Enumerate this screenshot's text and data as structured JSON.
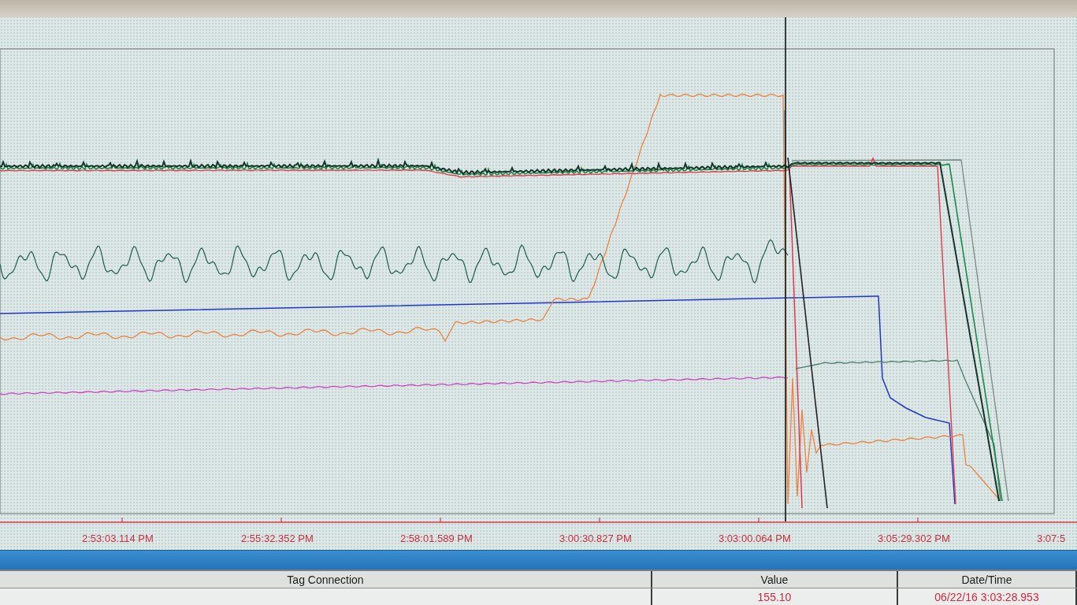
{
  "chart": {
    "time_axis": {
      "labels": [
        "2:53:03.114 PM",
        "2:55:32.352 PM",
        "2:58:01.589 PM",
        "3:00:30.827 PM",
        "3:03:00.064 PM",
        "3:05:29.302 PM",
        "3:07:5"
      ]
    }
  },
  "table": {
    "columns": [
      "Tag Connection",
      "Value",
      "Date/Time"
    ],
    "rows": [
      {
        "value": "155.10",
        "date_time": "06/22/16 3:03:28.953"
      }
    ]
  }
}
